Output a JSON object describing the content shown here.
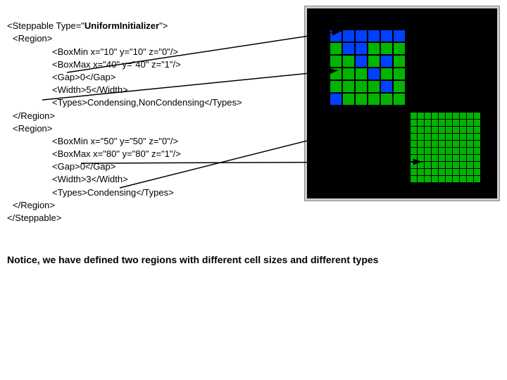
{
  "code": {
    "l1a": "<Steppable Type=\"",
    "l1b": "UniformInitializer",
    "l1c": "\">",
    "l2": "<Region>",
    "l3": "<BoxMin x=\"10\" y=\"10\" z=\"0\"/>",
    "l4": "<BoxMax x=\"40\" y=\"40\" z=\"1\"/>",
    "l5": "<Gap>0</Gap>",
    "l6": "<Width>5</Width>",
    "l7": "<Types>Condensing,NonCondensing</Types>",
    "l8": "</Region>",
    "l9": "<Region>",
    "l10": "<BoxMin x=\"50\" y=\"50\" z=\"0\"/>",
    "l11": "<BoxMax x=\"80\" y=\"80\" z=\"1\"/>",
    "l12": "<Gap>0</Gap>",
    "l13": "<Width>3</Width>",
    "l14": "<Types>Condensing</Types>",
    "l15": "</Region>",
    "l16": "</Steppable>"
  },
  "gridA": [
    [
      "blue",
      "blue",
      "blue",
      "blue",
      "blue",
      "blue"
    ],
    [
      "green",
      "blue",
      "blue",
      "green",
      "green",
      "green"
    ],
    [
      "green",
      "green",
      "blue",
      "green",
      "blue",
      "green"
    ],
    [
      "green",
      "green",
      "green",
      "blue",
      "green",
      "green"
    ],
    [
      "green",
      "green",
      "green",
      "green",
      "blue",
      "green"
    ],
    [
      "blue",
      "green",
      "green",
      "green",
      "green",
      "green"
    ]
  ],
  "caption": "Notice, we have defined two regions with different cell sizes and different types"
}
